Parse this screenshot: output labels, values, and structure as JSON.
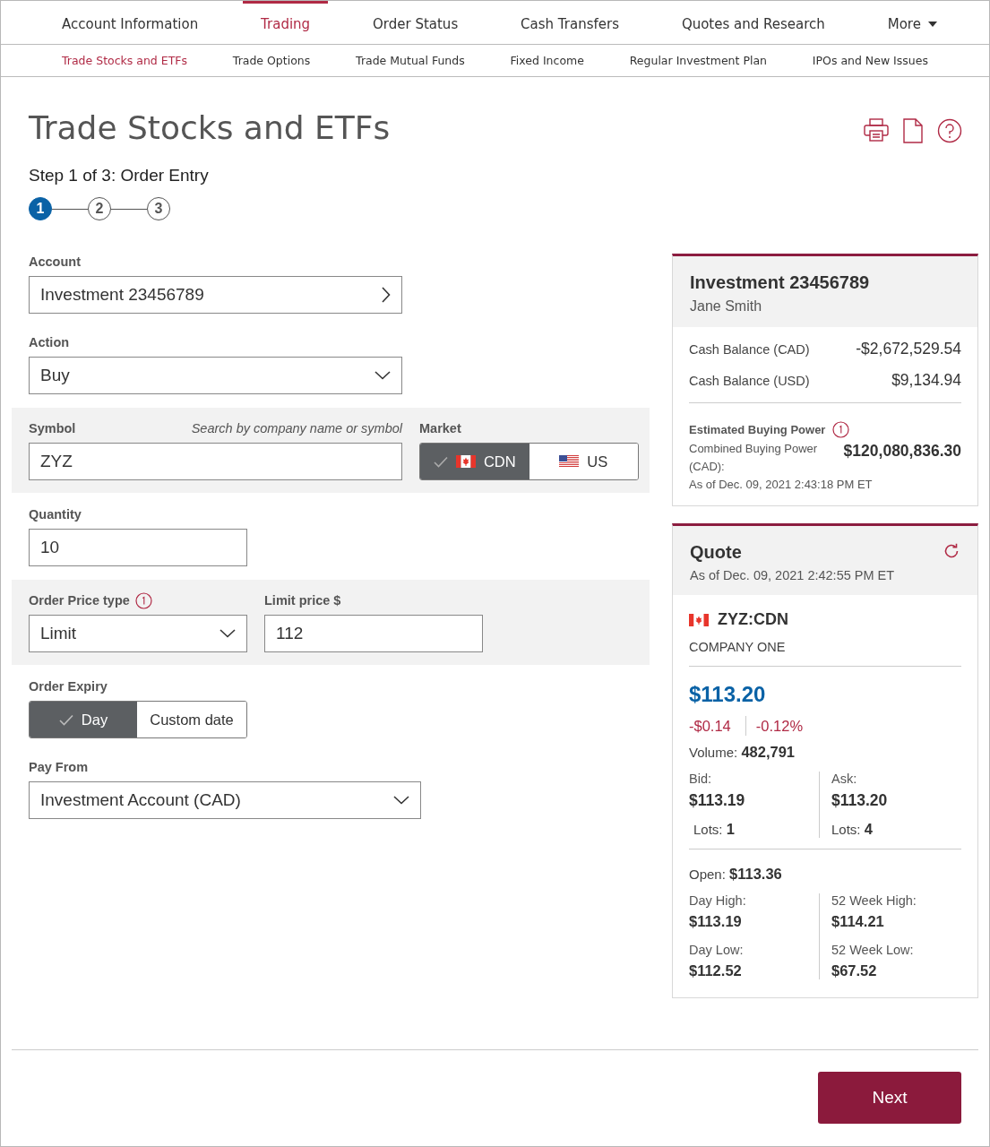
{
  "nav": [
    {
      "label": "Account Information",
      "selected": false
    },
    {
      "label": "Trading",
      "selected": true
    },
    {
      "label": "Order Status",
      "selected": false
    },
    {
      "label": "Cash Transfers",
      "selected": false
    },
    {
      "label": "Quotes and Research",
      "selected": false
    },
    {
      "label": "More",
      "selected": false,
      "kind": "menu"
    }
  ],
  "subnav": [
    {
      "label": "Trade Stocks and ETFs",
      "selected": true
    },
    {
      "label": "Trade Options",
      "selected": false
    },
    {
      "label": "Trade Mutual Funds",
      "selected": false
    },
    {
      "label": "Fixed Income",
      "selected": false
    },
    {
      "label": "Regular Investment Plan",
      "selected": false
    },
    {
      "label": "IPOs and New Issues",
      "selected": false
    }
  ],
  "page_title": "Trade Stocks and ETFs",
  "step_label": "Step 1 of 3: Order Entry",
  "steps": [
    {
      "label": "1",
      "selected": true
    },
    {
      "label": "2",
      "selected": false
    },
    {
      "label": "3",
      "selected": false
    }
  ],
  "form": {
    "account": {
      "label": "Account",
      "value": "Investment 23456789"
    },
    "action": {
      "label": "Action",
      "value": "Buy"
    },
    "symbol": {
      "label": "Symbol",
      "hint": "Search by company name or symbol",
      "value": "ZYZ"
    },
    "market": {
      "label": "Market",
      "options": [
        {
          "label": "CDN",
          "kind": "canada",
          "selected": true
        },
        {
          "label": "US",
          "kind": "usa",
          "selected": false
        }
      ]
    },
    "quantity": {
      "label": "Quantity",
      "value": "10"
    },
    "price_type": {
      "label": "Order Price type",
      "value": "Limit"
    },
    "limit_price": {
      "label": "Limit price $",
      "value": "112"
    },
    "expiry": {
      "label": "Order Expiry",
      "options": [
        {
          "label": "Day",
          "selected": true
        },
        {
          "label": "Custom date",
          "selected": false
        }
      ]
    },
    "pay_from": {
      "label": "Pay From",
      "value": "Investment Account (CAD)"
    }
  },
  "account_card": {
    "title": "Investment 23456789",
    "owner": "Jane Smith",
    "balances": [
      {
        "label": "Cash Balance (CAD)",
        "value": "-$2,672,529.54"
      },
      {
        "label": "Cash Balance (USD)",
        "value": "$9,134.94"
      }
    ],
    "buying_power": {
      "title": "Estimated Buying Power",
      "label": "Combined Buying Power (CAD):",
      "value": "$120,080,836.30",
      "as_of": "As of Dec. 09, 2021 2:43:18 PM ET"
    }
  },
  "quote": {
    "title": "Quote",
    "as_of": "As of Dec. 09, 2021 2:42:55 PM ET",
    "symbol": "ZYZ:CDN",
    "kind": "canada",
    "company": "COMPANY ONE",
    "price": "$113.20",
    "change": "-$0.14",
    "change_pct": "-0.12%",
    "volume": {
      "label": "Volume:",
      "value": "482,791"
    },
    "bid": {
      "label": "Bid:",
      "value": "$113.19",
      "lots_label": "Lots:",
      "lots": "1"
    },
    "ask": {
      "label": "Ask:",
      "value": "$113.20",
      "lots_label": "Lots:",
      "lots": "4"
    },
    "open": {
      "label": "Open:",
      "value": "$113.36"
    },
    "stats": [
      {
        "label": "Day High:",
        "value": "$113.19"
      },
      {
        "label": "52 Week High:",
        "value": "$114.21"
      },
      {
        "label": "Day Low:",
        "value": "$112.52"
      },
      {
        "label": "52 Week Low:",
        "value": "$67.52"
      }
    ]
  },
  "next_button": "Next"
}
